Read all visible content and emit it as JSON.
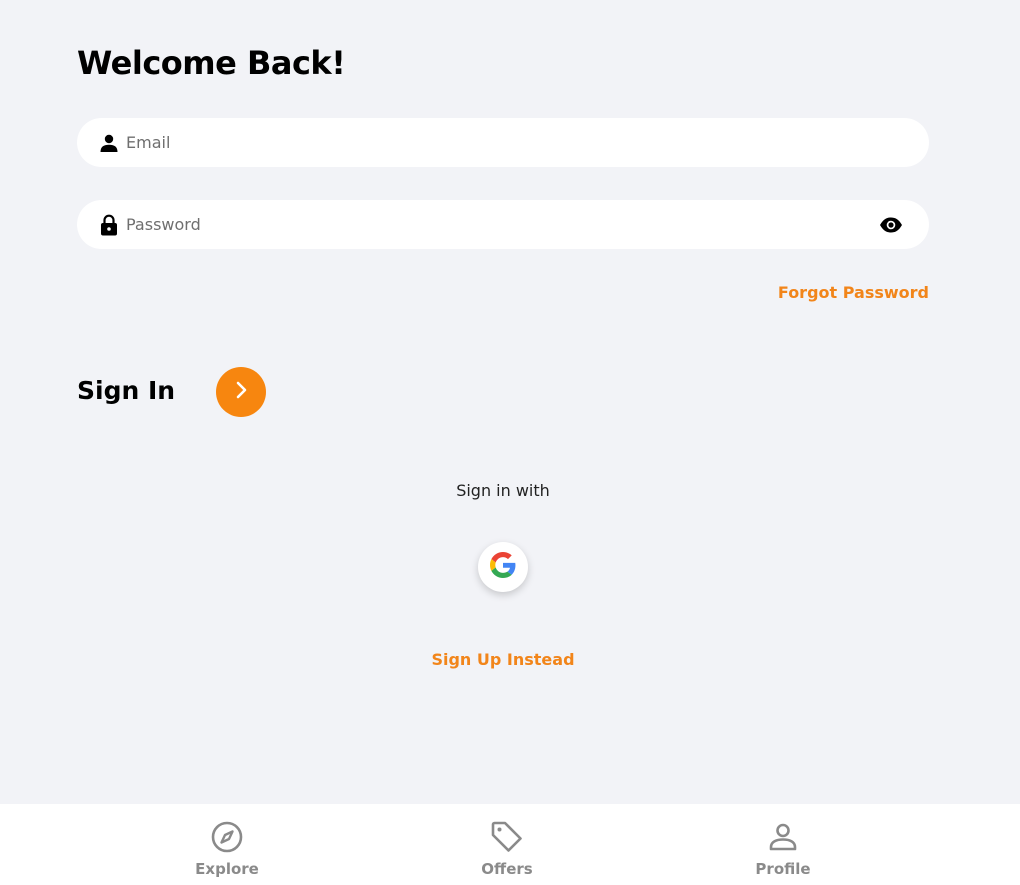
{
  "header": {
    "title": "Welcome Back!"
  },
  "form": {
    "email": {
      "placeholder": "Email",
      "value": "",
      "icon": "user-icon"
    },
    "password": {
      "placeholder": "Password",
      "value": "",
      "icon": "lock-icon",
      "toggle_icon": "eye-icon"
    },
    "forgot_password_label": "Forgot Password",
    "sign_in_label": "Sign In",
    "sign_in_button_icon": "chevron-right-icon"
  },
  "social": {
    "label": "Sign in with",
    "providers": [
      {
        "name": "google",
        "icon": "google-icon"
      }
    ]
  },
  "sign_up_label": "Sign Up Instead",
  "bottom_nav": {
    "items": [
      {
        "label": "Explore",
        "icon": "compass-icon"
      },
      {
        "label": "Offers",
        "icon": "tag-icon"
      },
      {
        "label": "Profile",
        "icon": "person-icon"
      }
    ]
  },
  "colors": {
    "accent": "#f7860f",
    "link": "#f2851a",
    "background": "#f2f3f7",
    "nav_inactive": "#8a8a8a"
  }
}
